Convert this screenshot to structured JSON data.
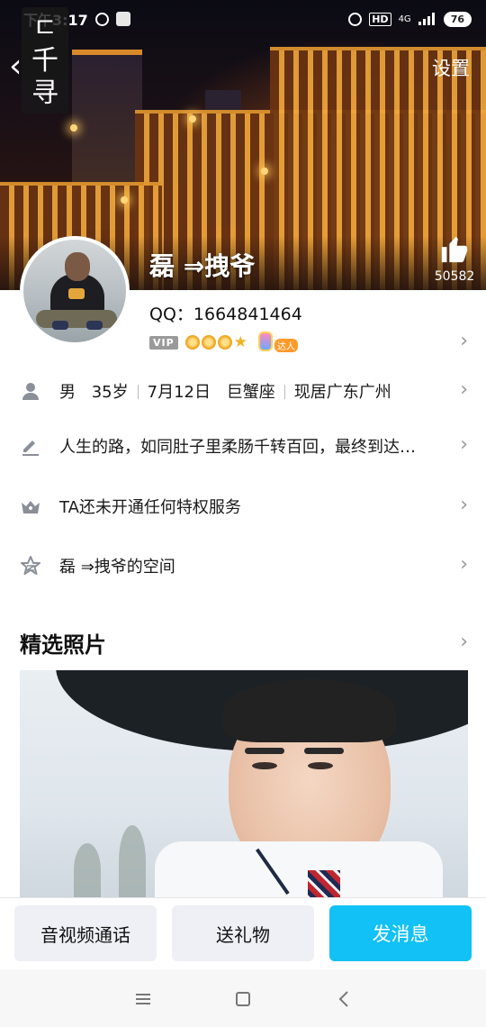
{
  "status_bar": {
    "time": "下午3:17",
    "battery": "76",
    "network": "4G",
    "hd": "HD"
  },
  "mini_app_tag": "ㅤ\n千\n寻",
  "header": {
    "back_glyph": "‹",
    "settings_label": "设置",
    "nickname": "磊 ⇒拽爷",
    "like_count": "50582"
  },
  "profile": {
    "qq_line": "QQ：1664841464",
    "vip_label": "VIP",
    "talent_tag": "达人"
  },
  "rows": [
    {
      "icon": "person-icon",
      "parts": [
        "男",
        "35岁",
        "7月12日",
        "巨蟹座",
        "现居广东广州"
      ]
    },
    {
      "icon": "pencil-icon",
      "text": "人生的路，如同肚子里柔肠千转百回，最终到达…"
    },
    {
      "icon": "crown-icon",
      "text": "TA还未开通任何特权服务"
    },
    {
      "icon": "star-icon",
      "text": "磊 ⇒拽爷的空间"
    }
  ],
  "photos_section": {
    "title": "精选照片"
  },
  "actions": {
    "call_label": "音视频通话",
    "gift_label": "送礼物",
    "message_label": "发消息"
  },
  "colors": {
    "primary": "#12c1f5",
    "button_gray": "#eef0f5",
    "icon_gray": "#8a8f99"
  }
}
